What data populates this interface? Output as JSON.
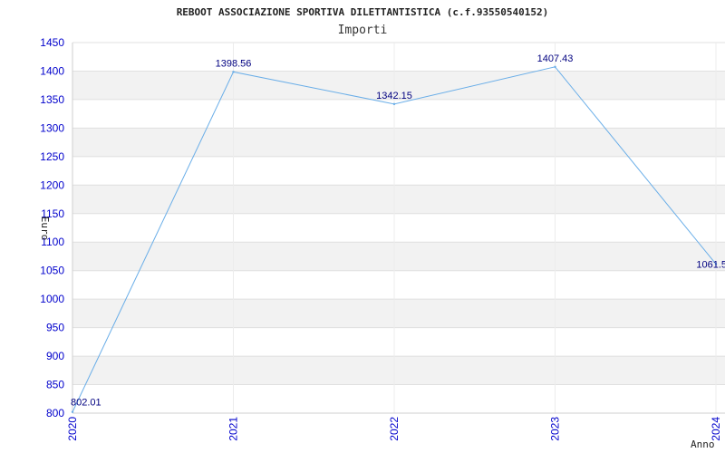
{
  "chart_data": {
    "type": "line",
    "title": "REBOOT ASSOCIAZIONE SPORTIVA DILETTANTISTICA (c.f.93550540152)",
    "subtitle": "Importi",
    "xlabel": "Anno",
    "ylabel": "Euro",
    "categories": [
      "2020",
      "2021",
      "2022",
      "2023",
      "2024"
    ],
    "values": [
      802.01,
      1398.56,
      1342.15,
      1407.43,
      1061.5
    ],
    "data_labels": [
      "802.01",
      "1398.56",
      "1342.15",
      "1407.43",
      "1061.5"
    ],
    "ylim": [
      800,
      1450
    ],
    "yticks": [
      800,
      850,
      900,
      950,
      1000,
      1050,
      1100,
      1150,
      1200,
      1250,
      1300,
      1350,
      1400,
      1450
    ],
    "grid": true,
    "line_color": "#6aaee8",
    "band_color": "#f2f2f2",
    "tick_color": "#0000cc",
    "label_color": "#000080"
  }
}
